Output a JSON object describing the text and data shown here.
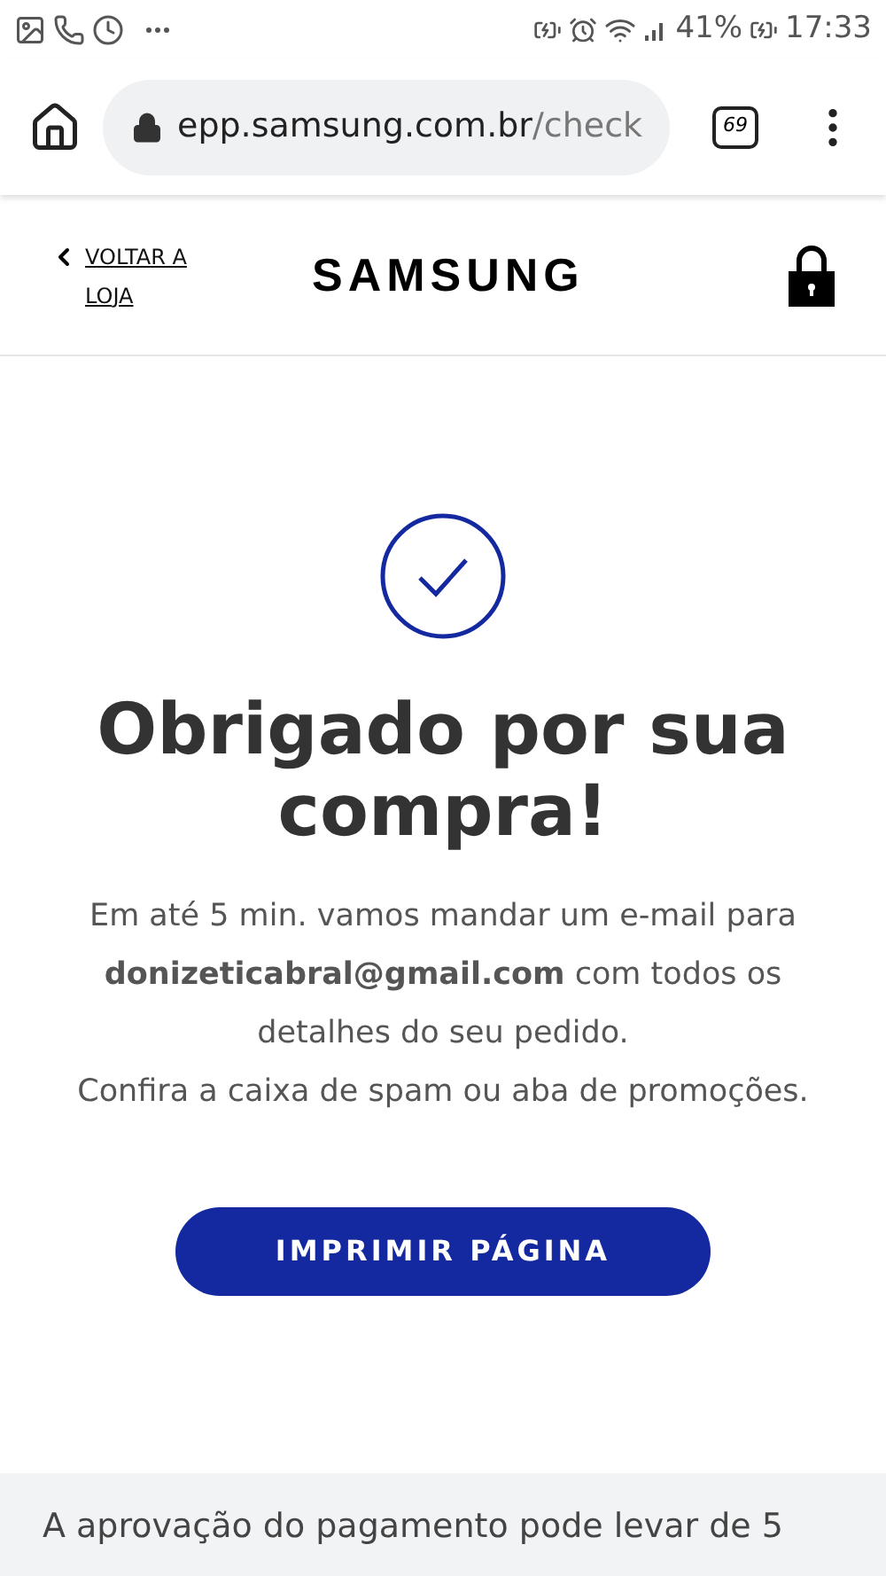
{
  "status_bar": {
    "battery": "41%",
    "time": "17:33"
  },
  "browser": {
    "url_host": "epp.samsung.com.br",
    "url_path": "/check",
    "tab_count": "69"
  },
  "header": {
    "back_link": "VOLTAR A LOJA",
    "logo": "SAMSUNG"
  },
  "confirmation": {
    "title": "Obrigado por sua compra!",
    "message": "Em até 5 min. vamos mandar um e-mail para **donizeticabral@gmail.com** com todos os detalhes do seu pedido.",
    "note": "Confira a caixa de spam ou aba de promoções.",
    "button": "IMPRIMIR PÁGINA"
  },
  "footer_note": "A aprovação do pagamento pode levar de 5"
}
